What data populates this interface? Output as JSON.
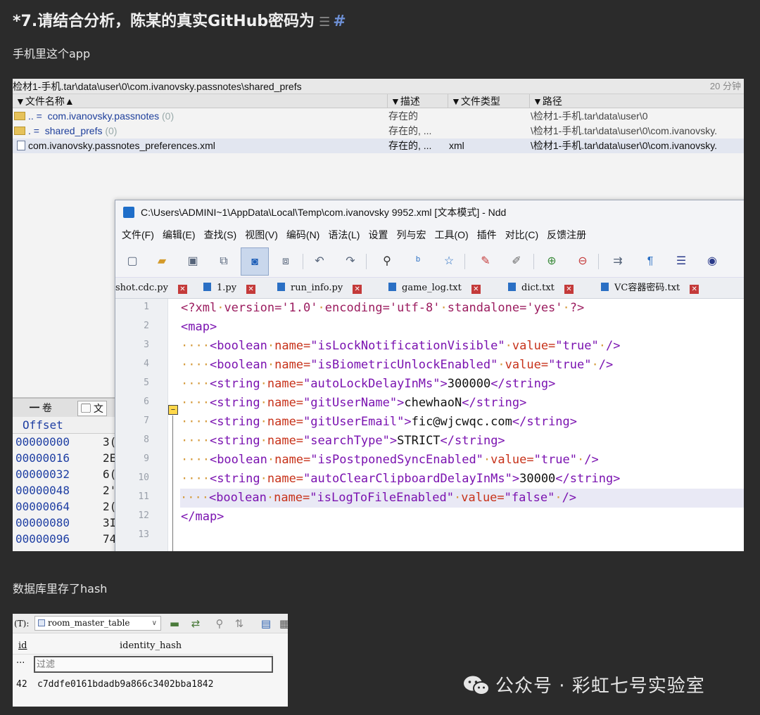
{
  "heading": {
    "title": "*7.请结合分析，陈某的真实GitHub密码为",
    "hash": "#",
    "list_icon": "☰"
  },
  "para1": "手机里这个app",
  "para2": "数据库里存了hash",
  "explorer": {
    "path": "检材1-手机.tar\\data\\user\\0\\com.ivanovsky.passnotes\\shared_prefs",
    "count": "20 分钟",
    "columns": [
      "文件名称",
      "描述",
      "文件类型",
      "路径"
    ],
    "rows": [
      {
        "name": "com.ivanovsky.passnotes",
        "prefix": "..  =",
        "count": "(0)",
        "desc": "存在的",
        "type": "",
        "path": "\\检材1-手机.tar\\data\\user\\0"
      },
      {
        "name": "shared_prefs",
        "prefix": ".  =",
        "count": "(0)",
        "desc": "存在的, ...",
        "type": "",
        "path": "\\检材1-手机.tar\\data\\user\\0\\com.ivanovsky."
      },
      {
        "name": "com.ivanovsky.passnotes_preferences.xml",
        "prefix": "",
        "count": "",
        "desc": "存在的, ...",
        "type": "xml",
        "path": "\\检材1-手机.tar\\data\\user\\0\\com.ivanovsky."
      }
    ]
  },
  "hexpane": {
    "tab1": "━ 卷",
    "tab2": "文",
    "offset_header": "Offset",
    "rows": [
      {
        "off": "00000000",
        "v": "3("
      },
      {
        "off": "00000016",
        "v": "2E"
      },
      {
        "off": "00000032",
        "v": "6("
      },
      {
        "off": "00000048",
        "v": "2'"
      },
      {
        "off": "00000064",
        "v": "2("
      },
      {
        "off": "00000080",
        "v": "3I"
      },
      {
        "off": "00000096",
        "v": "74"
      }
    ]
  },
  "editor": {
    "title": "C:\\Users\\ADMINI~1\\AppData\\Local\\Temp\\com.ivanovsky 9952.xml [文本模式] - Ndd",
    "menu": [
      "文件(F)",
      "编辑(E)",
      "查找(S)",
      "视图(V)",
      "编码(N)",
      "语法(L)",
      "设置",
      "列与宏",
      "工具(O)",
      "插件",
      "对比(C)",
      "反馈注册"
    ],
    "tabs": [
      "shot.cdc.py",
      "1.py",
      "run_info.py",
      "game_log.txt",
      "dict.txt",
      "VC容器密码.txt"
    ],
    "line_numbers": [
      "1",
      "2",
      "3",
      "4",
      "5",
      "6",
      "7",
      "8",
      "9",
      "10",
      "11",
      "12",
      "13"
    ],
    "lines": {
      "l1": {
        "a": "<?xml",
        "b": "version='1.0'",
        "c": "encoding='utf-8'",
        "d": "standalone='yes'",
        "e": "?>"
      },
      "l2": "<map>",
      "l3": {
        "tag": "<boolean",
        "n": "name=",
        "nv": "\"isLockNotificationVisible\"",
        "v": "value=",
        "vv": "\"true\"",
        "end": "/>"
      },
      "l4": {
        "tag": "<boolean",
        "n": "name=",
        "nv": "\"isBiometricUnlockEnabled\"",
        "v": "value=",
        "vv": "\"true\"",
        "end": "/>"
      },
      "l5": {
        "tag": "<string",
        "n": "name=",
        "nv": "\"autoLockDelayInMs\"",
        "gt": ">",
        "text": "300000",
        "close": "</string>"
      },
      "l6": {
        "tag": "<string",
        "n": "name=",
        "nv": "\"gitUserName\"",
        "gt": ">",
        "text": "chewhaoN",
        "close": "</string>"
      },
      "l7": {
        "tag": "<string",
        "n": "name=",
        "nv": "\"gitUserEmail\"",
        "gt": ">",
        "text": "fic@wjcwqc.com",
        "close": "</string>"
      },
      "l8": {
        "tag": "<string",
        "n": "name=",
        "nv": "\"searchType\"",
        "gt": ">",
        "text": "STRICT",
        "close": "</string>"
      },
      "l9": {
        "tag": "<boolean",
        "n": "name=",
        "nv": "\"isPostponedSyncEnabled\"",
        "v": "value=",
        "vv": "\"true\"",
        "end": "/>"
      },
      "l10": {
        "tag": "<string",
        "n": "name=",
        "nv": "\"autoClearClipboardDelayInMs\"",
        "gt": ">",
        "text": "30000",
        "close": "</string>"
      },
      "l11": {
        "tag": "<boolean",
        "n": "name=",
        "nv": "\"isLogToFileEnabled\"",
        "v": "value=",
        "vv": "\"false\"",
        "end": "/>"
      },
      "l12": "</map>"
    }
  },
  "db": {
    "table_label": "(T):",
    "table": "room_master_table",
    "col_id": "id",
    "col_hash": "identity_hash",
    "filter_mark": "···",
    "filter_placeholder": "过滤",
    "row_id": "42",
    "row_hash": "c7ddfe0161bdadb9a866c3402bba1842"
  },
  "watermark": "公众号 · 彩虹七号实验室"
}
